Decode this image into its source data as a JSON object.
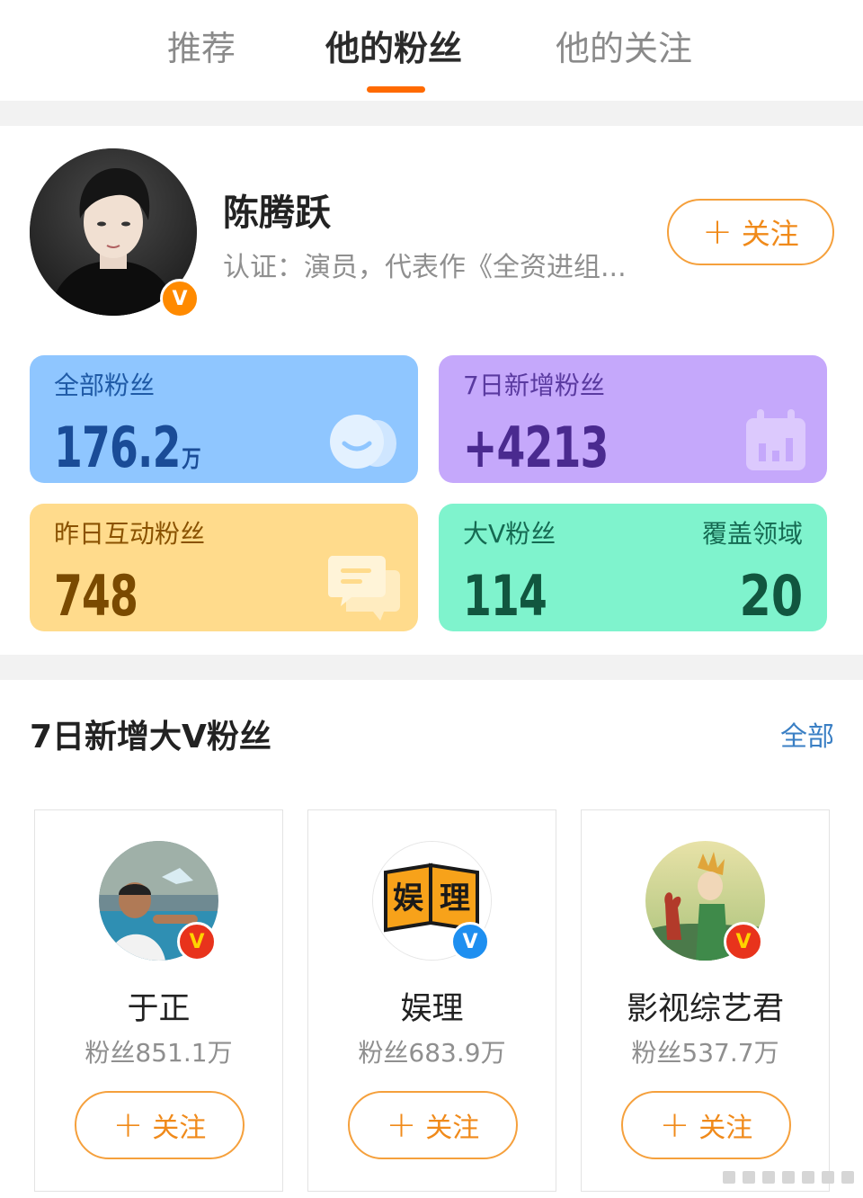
{
  "tabs": [
    {
      "label": "推荐",
      "active": false
    },
    {
      "label": "他的粉丝",
      "active": true
    },
    {
      "label": "他的关注",
      "active": false
    }
  ],
  "profile": {
    "name": "陈腾跃",
    "verification": "认证：演员，代表作《全资进组...",
    "follow_label": "关注",
    "badge": "V"
  },
  "stats": {
    "total_fans": {
      "label": "全部粉丝",
      "value": "176.2",
      "unit": "万"
    },
    "new_7d": {
      "label": "7日新增粉丝",
      "value": "+4213"
    },
    "interact_yesterday": {
      "label": "昨日互动粉丝",
      "value": "748"
    },
    "big_v": {
      "label": "大V粉丝",
      "value": "114",
      "coverage_label": "覆盖领域",
      "coverage_value": "20"
    }
  },
  "section": {
    "title": "7日新增大V粉丝",
    "see_all": "全部"
  },
  "fans": [
    {
      "name": "于正",
      "count": "粉丝851.1万",
      "follow_label": "关注",
      "badge": "V",
      "badge_color": "#e8331c"
    },
    {
      "name": "娱理",
      "count": "粉丝683.9万",
      "follow_label": "关注",
      "badge": "V",
      "badge_color": "#1e8ff0",
      "logo_text": [
        "娱",
        "理"
      ]
    },
    {
      "name": "影视综艺君",
      "count": "粉丝537.7万",
      "follow_label": "关注",
      "badge": "V",
      "badge_color": "#e8331c"
    }
  ],
  "colors": {
    "accent": "#ff6a00",
    "follow": "#f08a1a",
    "link": "#3a7fc4"
  }
}
